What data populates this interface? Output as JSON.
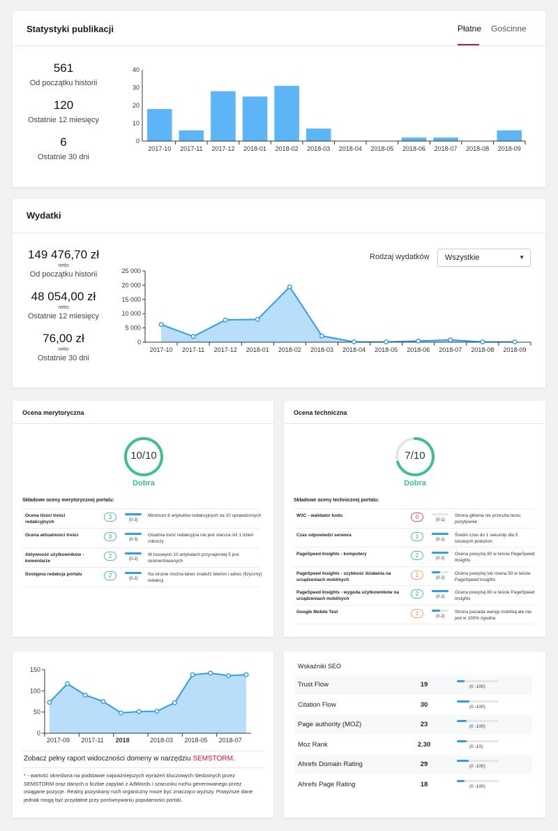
{
  "publications": {
    "title": "Statystyki publikacji",
    "tabs": [
      {
        "label": "Płatne",
        "active": true
      },
      {
        "label": "Gościnne",
        "active": false
      }
    ],
    "stats": [
      {
        "value": "561",
        "label": "Od początku historii"
      },
      {
        "value": "120",
        "label": "Ostatnie 12 miesięcy"
      },
      {
        "value": "6",
        "label": "Ostatnie 30 dni"
      }
    ]
  },
  "expenses": {
    "title": "Wydatki",
    "filter_label": "Rodzaj wydatków",
    "filter_value": "Wszystkie",
    "stats": [
      {
        "value": "149 476,70 zł",
        "sub": "netto",
        "label": "Od początku historii"
      },
      {
        "value": "48 054,00 zł",
        "sub": "netto",
        "label": "Ostatnie 12 miesięcy"
      },
      {
        "value": "76,00 zł",
        "sub": "netto",
        "label": "Ostatnie 30 dni"
      }
    ]
  },
  "merit": {
    "title": "Ocena merytoryczna",
    "score": "10/10",
    "score_fraction": 1.0,
    "grade": "Dobra",
    "components_title": "Składowe oceny merytorycznej portalu:",
    "rows": [
      {
        "name": "Ocena ilości treści redakcyjnych",
        "score": "3",
        "range": "(0-3)",
        "fill": 1.0,
        "desc": "Minimum 8 artykułów redakcyjnych na 10 sprawdzonych",
        "status": "green"
      },
      {
        "name": "Ocena aktualności treści",
        "score": "3",
        "range": "(0-3)",
        "fill": 1.0,
        "desc": "Ostatnia treść redakcyjna nie jest starsza niż 1 dzień roboczy",
        "status": "green"
      },
      {
        "name": "Aktywność użytkowników - komentarze",
        "score": "2",
        "range": "(0-2)",
        "fill": 1.0,
        "desc": "W losowych 10 artykułach przynajmniej 5 jest skomentowanych",
        "status": "green"
      },
      {
        "name": "Dostępna redakcja portalu",
        "score": "2",
        "range": "(0-2)",
        "fill": 1.0,
        "desc": "Na stronie można łatwo znaleźć telefon i adres (fizyczny) redakcji",
        "status": "green"
      }
    ]
  },
  "technical": {
    "title": "Ocena techniczna",
    "score": "7/10",
    "score_fraction": 0.7,
    "grade": "Dobra",
    "components_title": "Składowe oceny technicznej portalu:",
    "rows": [
      {
        "name": "W3C - walidator kodu",
        "score": "0",
        "range": "(0-1)",
        "fill": 0.0,
        "desc": "Strona główna nie przeszła testu pozytywnie",
        "status": "red"
      },
      {
        "name": "Czas odpowiedzi serwera",
        "score": "1",
        "range": "(0-1)",
        "fill": 1.0,
        "desc": "Średni czas do 1 sekundy dla 5 losowych podstron",
        "status": "green"
      },
      {
        "name": "PageSpeed Insights - komputery",
        "score": "2",
        "range": "(0-2)",
        "fill": 1.0,
        "desc": "Ocena powyżej 80 w teście PageSpeed Insights",
        "status": "green"
      },
      {
        "name": "PageSpeed Insights - szybkość działania na urządzeniach mobilnych",
        "score": "1",
        "range": "(0-2)",
        "fill": 0.5,
        "desc": "Ocena powyżej lub równa 50 w teście PageSpeed Insights",
        "status": "orange"
      },
      {
        "name": "PageSpeed Insights - wygoda użytkowników na urządzeniach mobilnych",
        "score": "2",
        "range": "(0-2)",
        "fill": 1.0,
        "desc": "Ocena powyżej 80 w teście PageSpeed Insights",
        "status": "green"
      },
      {
        "name": "Google Mobile Test",
        "score": "1",
        "range": "(0-2)",
        "fill": 0.5,
        "desc": "Strona posiada wersję mobilną ale nie jest w 100% zgodna",
        "status": "orange"
      }
    ]
  },
  "visibility": {
    "report_text": "Zobacz pełny raport widoczności domeny w narzędziu ",
    "report_link": "SEMSTORM",
    "report_suffix": ".",
    "footnote": "* - wartość określona na podstawie najważniejszych wyrażeń kluczowych śledzonych przez SEMSTORM oraz danych o liczbie zapytań z AdWords i szacunku ruchu generowanego przez osiągane pozycje. Realny pozyskany ruch organiczny może być znacząco wyższy. Powyższe dane jednak mogą być przydatne przy porównywaniu popularności portali."
  },
  "seo": {
    "title": "Wskaźniki SEO",
    "rows": [
      {
        "name": "Trust Flow",
        "value": "19",
        "range": "(0 -100)",
        "fill": 0.19
      },
      {
        "name": "Citation Flow",
        "value": "30",
        "range": "(0 -100)",
        "fill": 0.3
      },
      {
        "name": "Page authority (MOZ)",
        "value": "23",
        "range": "(0 -100)",
        "fill": 0.23
      },
      {
        "name": "Moz Rank",
        "value": "2.30",
        "range": "(0 -10)",
        "fill": 0.23
      },
      {
        "name": "Ahrefs Domain Rating",
        "value": "29",
        "range": "(0 -100)",
        "fill": 0.29
      },
      {
        "name": "Ahrefs Page Rating",
        "value": "18",
        "range": "(0 -100)",
        "fill": 0.18
      }
    ]
  },
  "colors": {
    "accent": "#c9153b",
    "bar": "#5bb5f7",
    "line": "#2d9cea",
    "area": "#b9def9",
    "good": "#3cbf94"
  },
  "chart_data": [
    {
      "type": "bar",
      "categories": [
        "2017-10",
        "2017-11",
        "2017-12",
        "2018-01",
        "2018-02",
        "2018-03",
        "2018-04",
        "2018-05",
        "2018-06",
        "2018-07",
        "2018-08",
        "2018-09"
      ],
      "values": [
        18,
        6,
        28,
        25,
        31,
        7,
        0,
        0,
        2,
        2,
        0,
        6
      ],
      "ylim": [
        0,
        40
      ],
      "yticks": [
        0,
        10,
        20,
        30,
        40
      ]
    },
    {
      "type": "area",
      "categories": [
        "2017-10",
        "2017-11",
        "2017-12",
        "2018-01",
        "2018-02",
        "2018-03",
        "2018-04",
        "2018-05",
        "2018-06",
        "2018-07",
        "2018-08",
        "2018-09"
      ],
      "values": [
        6200,
        2000,
        7800,
        8000,
        19400,
        2200,
        100,
        100,
        400,
        800,
        100,
        100
      ],
      "ylim": [
        0,
        25000
      ],
      "yticks": [
        "0",
        "5 000",
        "10 000",
        "15 000",
        "20 000",
        "25 000"
      ]
    },
    {
      "type": "area",
      "x_labels": [
        "2017-09",
        "2017-11",
        "2018",
        "2018-03",
        "2018-05",
        "2018-07"
      ],
      "values": [
        73,
        117,
        90,
        75,
        48,
        51,
        52,
        72,
        138,
        142,
        136,
        138
      ],
      "ylim": [
        0,
        150
      ],
      "yticks": [
        0,
        50,
        100,
        150
      ]
    }
  ]
}
